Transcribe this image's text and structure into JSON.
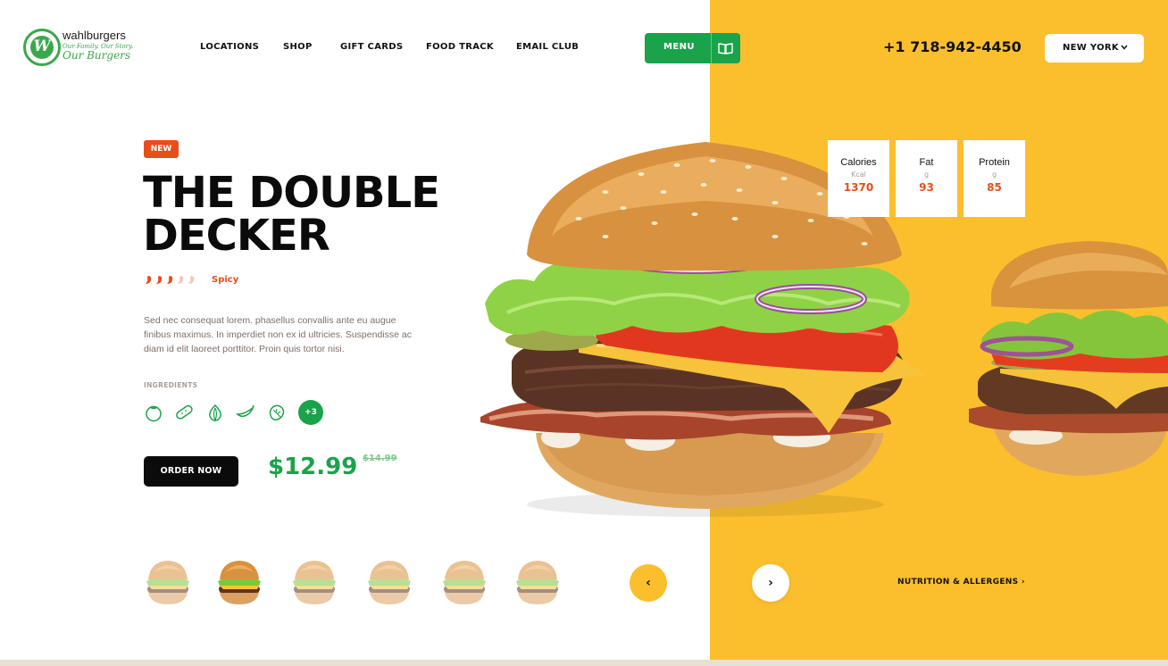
{
  "brand": {
    "name": "wahlburgers",
    "tagline": "Our Family. Our Story.",
    "tagline_script": "Our Burgers",
    "accent_green": "#1aa34a",
    "accent_orange": "#e94d1c",
    "accent_yellow": "#fbbf2e"
  },
  "nav": {
    "items": [
      "LOCATIONS",
      "SHOP",
      "GIFT CARDS",
      "FOOD TRACK",
      "EMAIL CLUB"
    ],
    "menu_label": "MENU",
    "menu_icon": "open-book-icon",
    "phone": "+1 718-942-4450",
    "city": "NEW YORK",
    "city_icon": "chevron-down-icon"
  },
  "product": {
    "badge": "NEW",
    "title_line1": "THE DOUBLE",
    "title_line2": "DECKER",
    "spice_level": 3,
    "spice_max": 5,
    "spice_label": "Spicy",
    "description": "Sed nec consequat lorem. phasellus convallis ante eu augue finibus maximus. In imperdiet non ex id ultricies. Suspendisse ac diam id elit laoreet porttitor. Proin quis tortor nisi.",
    "ingredients_label": "INGREDIENTS",
    "ingredients": [
      "tomato-icon",
      "pickle-icon",
      "onion-icon",
      "chili-pepper-icon",
      "lettuce-icon"
    ],
    "more_ingredients": "+3",
    "order_label": "ORDER NOW",
    "price": "$12.99",
    "old_price": "$14.99"
  },
  "nutrition": [
    {
      "name": "Calories",
      "unit": "Kcal",
      "value": "1370"
    },
    {
      "name": "Fat",
      "unit": "g",
      "value": "93"
    },
    {
      "name": "Protein",
      "unit": "g",
      "value": "85"
    }
  ],
  "carousel": {
    "thumbnails": [
      "burger-thumb-1",
      "burger-thumb-2",
      "burger-thumb-3",
      "burger-thumb-4",
      "burger-thumb-5",
      "burger-thumb-6"
    ],
    "active_index": 1,
    "prev_icon": "chevron-left-icon",
    "next_icon": "chevron-right-icon",
    "prev_glyph": "‹",
    "next_glyph": "›",
    "nutrition_link": "NUTRITION & ALLERGENS ›"
  }
}
